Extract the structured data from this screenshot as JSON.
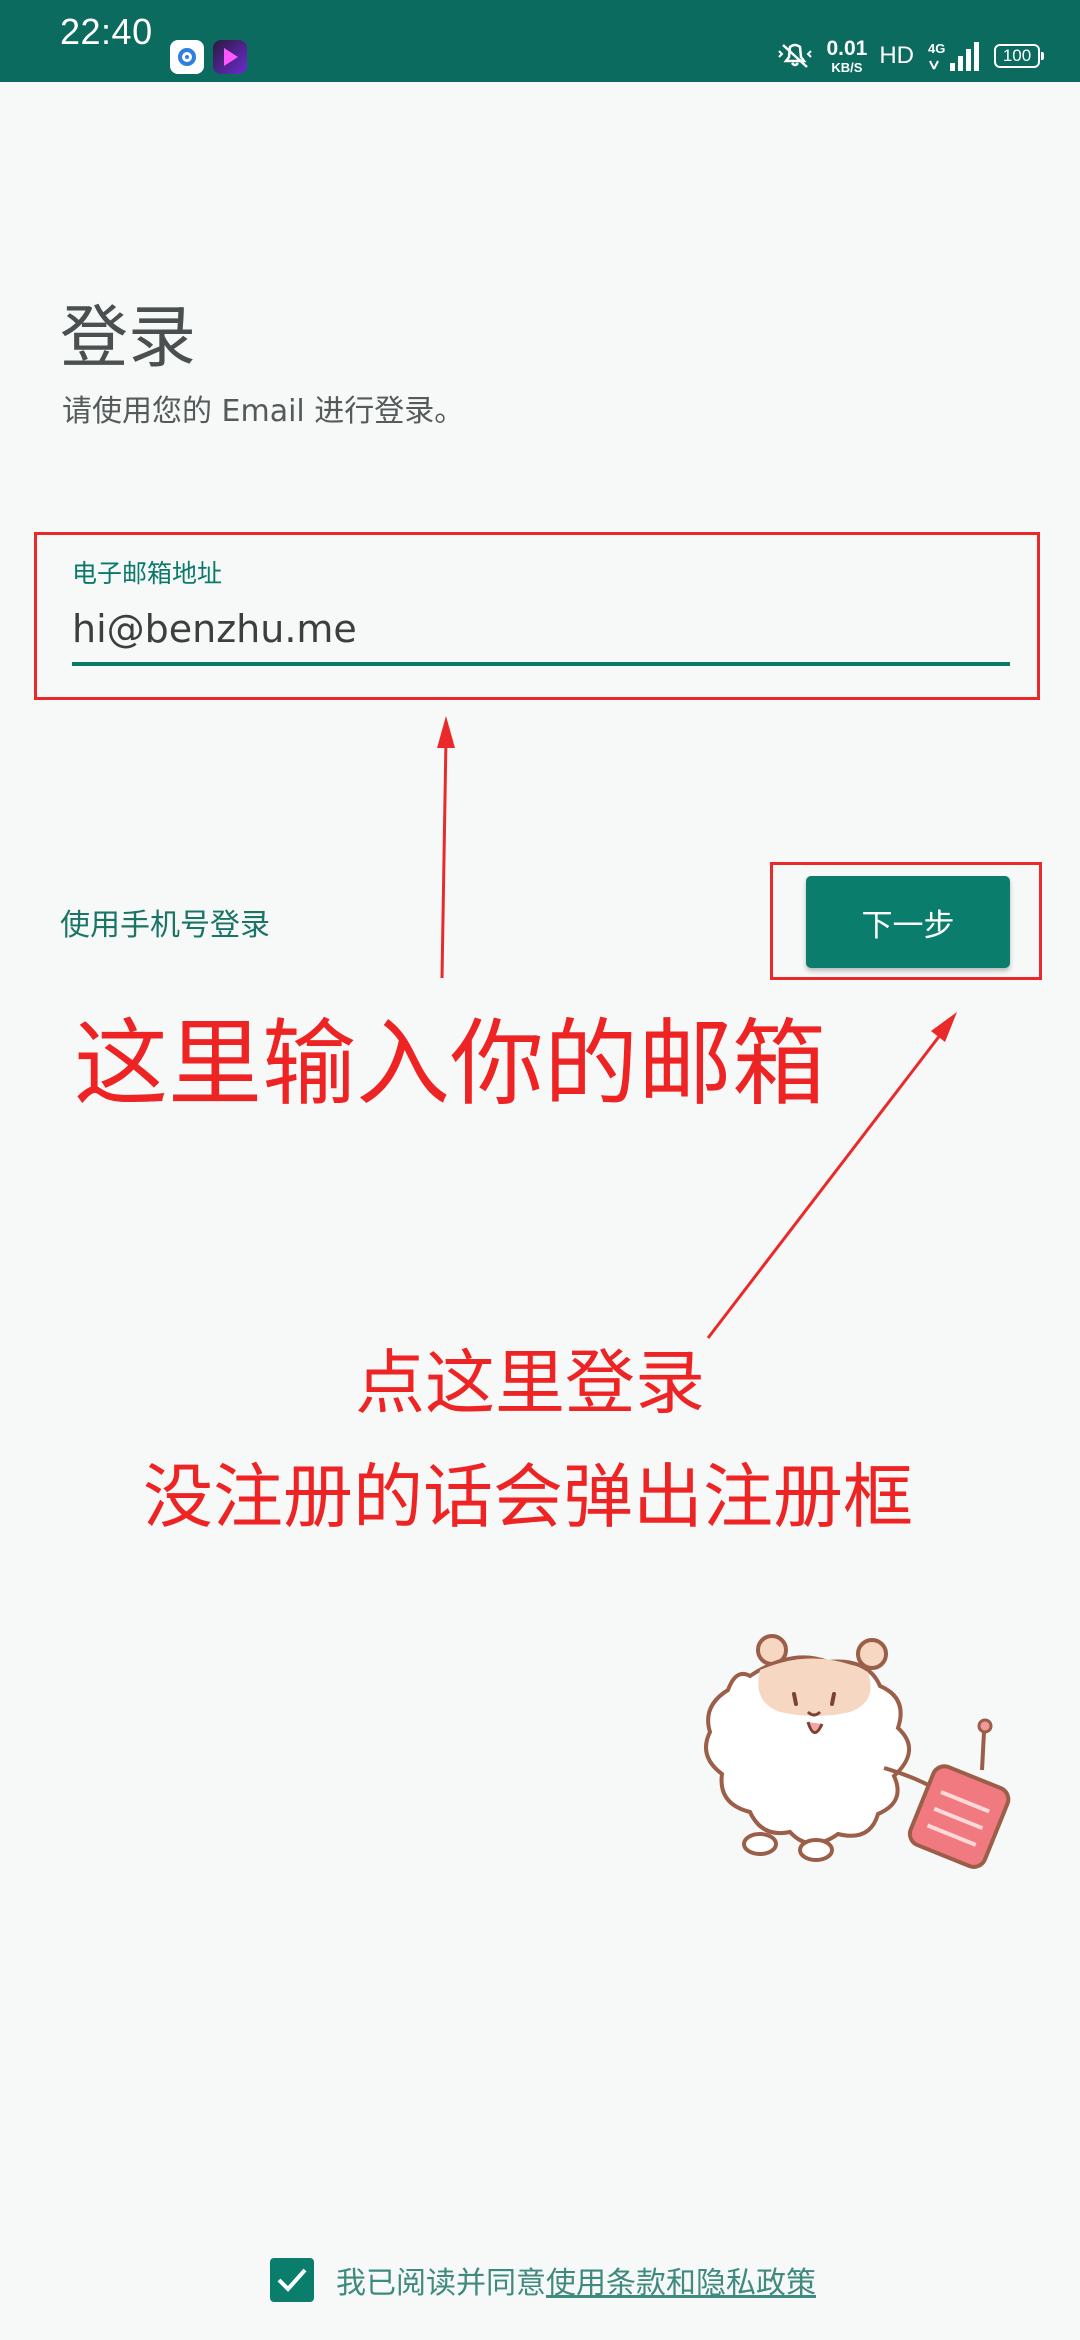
{
  "status_bar": {
    "time": "22:40",
    "net_speed_value": "0.01",
    "net_speed_unit": "KB/S",
    "hd_label": "HD",
    "network_label": "4G",
    "battery_level": "100",
    "icons": [
      "blue-app-icon",
      "purple-video-app-icon",
      "vibrate-mute-icon",
      "signal-icon",
      "battery-icon"
    ],
    "background_color": "#0b6b5e"
  },
  "header": {
    "title": "登录",
    "subtitle": "请使用您的 Email 进行登录。"
  },
  "email_field": {
    "label": "电子邮箱地址",
    "value": "hi@benzhu.me",
    "accent_color": "#0b7a6a"
  },
  "actions": {
    "phone_login_label": "使用手机号登录",
    "next_label": "下一步"
  },
  "annotations": {
    "email_hint": "这里输入你的邮箱",
    "login_hint_line1": "点这里登录",
    "login_hint_line2": "没注册的话会弹出注册框",
    "color": "#ee2424"
  },
  "terms": {
    "checked": true,
    "prefix": "我已阅读并同意",
    "link": "使用条款和隐私政策"
  }
}
